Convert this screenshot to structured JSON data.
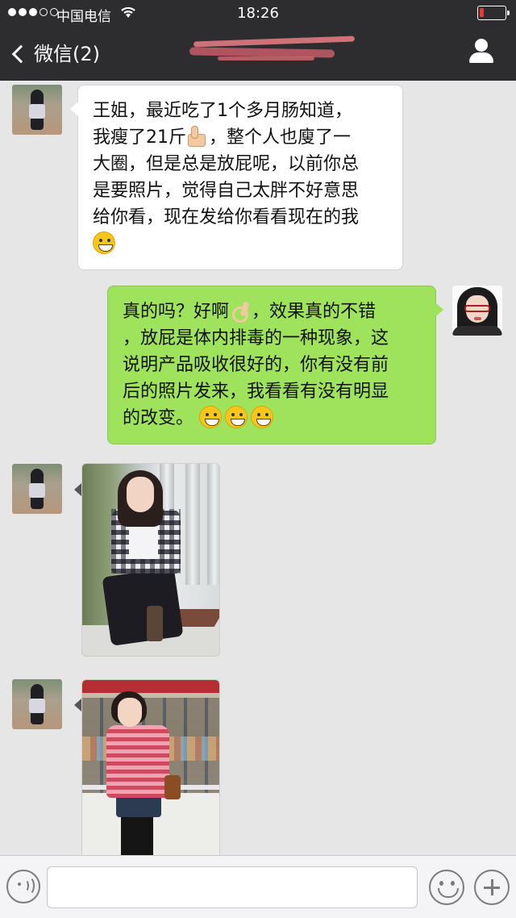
{
  "status_bar": {
    "carrier": "中国电信",
    "time": "18:26",
    "signal_bars_filled": 3,
    "signal_bars_total": 5,
    "wifi_icon": "wifi-icon",
    "battery_level_fraction": 0.08,
    "battery_color": "#e53935"
  },
  "nav": {
    "back_label": "微信(2)",
    "title": "",
    "title_obscured": true,
    "profile_icon": "person-icon"
  },
  "messages": [
    {
      "side": "in",
      "type": "text",
      "lines": [
        "王姐，最近吃了1个多月肠知道，",
        "我瘦了21斤",
        "，整个人也廋了一",
        "大圈，但是总是放屁呢，以前你总",
        "是要照片，觉得自己太胖不好意思",
        "给你看，现在发给你看看现在的我"
      ],
      "emoji": [
        "thumbs-up-emoji",
        "grin-emoji"
      ]
    },
    {
      "side": "out",
      "type": "text",
      "lines": [
        "真的吗？好啊",
        "，效果真的不错",
        "，放屁是体内排毒的一种现象，这",
        "说明产品吸收很好的，你有没有前",
        "后的照片发来，我看看有没有明显",
        "的改变。"
      ],
      "emoji": [
        "ok-hand-emoji",
        "smile-emoji",
        "smile-emoji",
        "smile-emoji"
      ]
    },
    {
      "side": "in",
      "type": "image",
      "image_name": "photo-woman-plaid-shirt"
    },
    {
      "side": "in",
      "type": "image",
      "image_name": "photo-woman-pink-shirt"
    }
  ],
  "input_bar": {
    "placeholder": "",
    "voice_icon": "voice-icon",
    "emoji_icon": "emoji-icon",
    "plus_icon": "plus-icon"
  },
  "colors": {
    "nav_bg": "#2d2d30",
    "chat_bg": "#e6e6e6",
    "out_bubble": "#9fe25c",
    "in_bubble": "#ffffff"
  }
}
